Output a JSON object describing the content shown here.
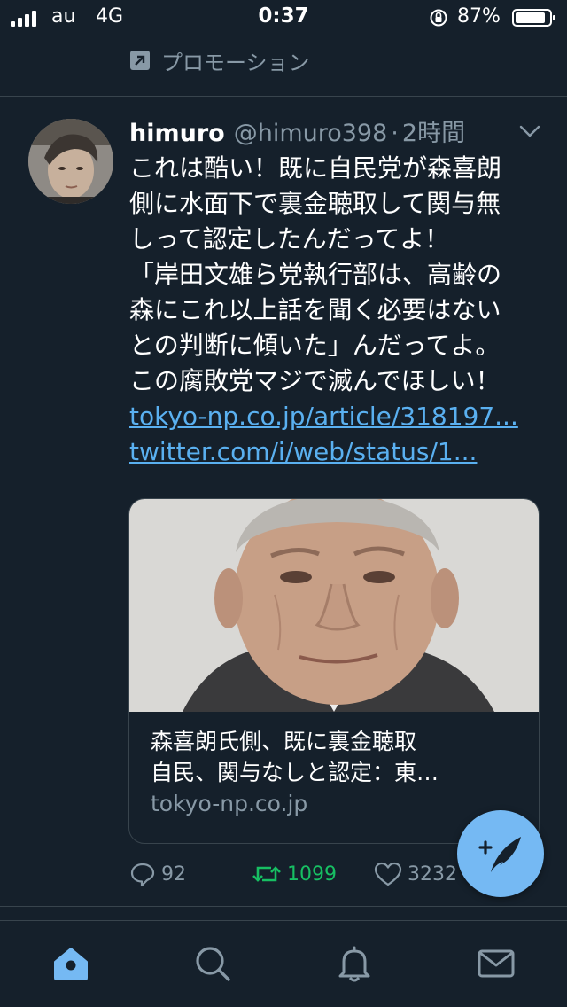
{
  "status_bar": {
    "carrier": "au",
    "network": "4G",
    "time": "0:37",
    "battery_percent": "87%"
  },
  "promoted": {
    "label": "プロモーション",
    "icon": "promoted-arrow-icon"
  },
  "tweet": {
    "display_name": "himuro",
    "handle": "@himuro398",
    "separator": "·",
    "time": "2時間",
    "text_lines": [
      "これは酷い！既に自民党が森喜朗",
      "側に水面下で裏金聴取して関与無",
      "しって認定したんだってよ！",
      "「岸田文雄ら党執行部は、高齢の",
      "森にこれ以上話を聞く必要はない",
      "との判断に傾いた」んだってよ。",
      "この腐敗党マジで滅んでほしい！"
    ],
    "links": [
      "tokyo-np.co.jp/article/318197...",
      "twitter.com/i/web/status/1..."
    ],
    "card": {
      "title_lines": [
        "森喜朗氏側、既に裏金聴取",
        "自民、関与なしと認定：東…"
      ],
      "domain": "tokyo-np.co.jp"
    },
    "actions": {
      "reply_count": "92",
      "retweet_count": "1099",
      "like_count": "3232"
    }
  },
  "colors": {
    "background": "#15202b",
    "divider": "#38444d",
    "secondary_text": "#8899a6",
    "link": "#5ab0f0",
    "retweet_green": "#17bf63",
    "accent": "#75b9f3"
  },
  "tab_bar": {
    "tabs": [
      "home-icon",
      "search-icon",
      "notifications-bell-icon",
      "messages-envelope-icon"
    ],
    "active": "home-icon"
  }
}
